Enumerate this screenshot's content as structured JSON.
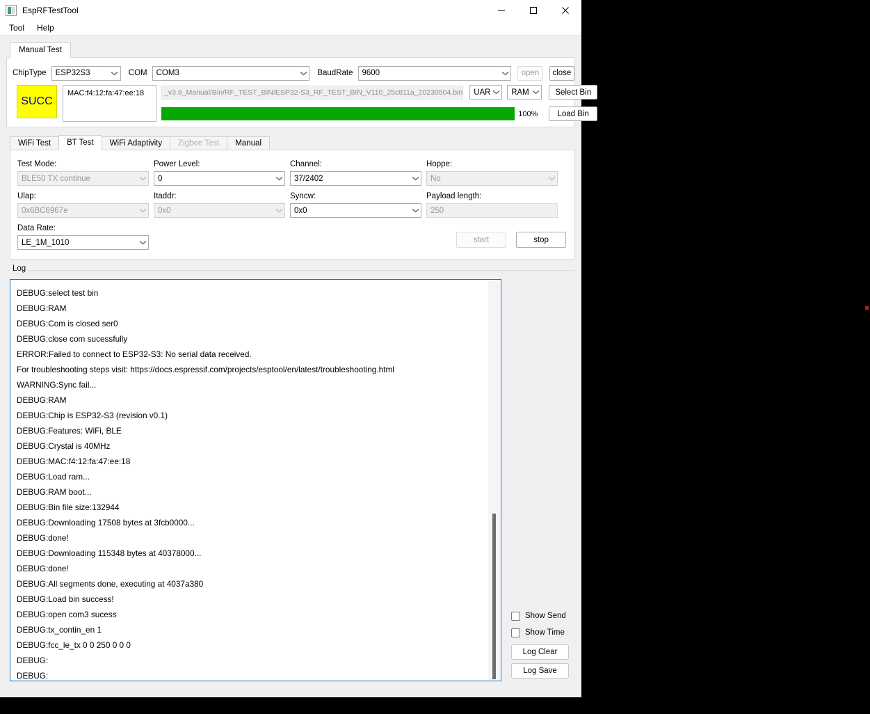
{
  "window": {
    "title": "EspRFTestTool",
    "icon": "app-icon",
    "minimize_label": "—",
    "maximize_label": "□",
    "close_label": "✕"
  },
  "menubar": {
    "items": [
      "Tool",
      "Help"
    ]
  },
  "outer_tabs": [
    {
      "label": "Manual Test",
      "active": true
    }
  ],
  "connection": {
    "chiptype_label": "ChipType",
    "chiptype_value": "ESP32S3",
    "com_label": "COM",
    "com_value": "COM3",
    "baudrate_label": "BaudRate",
    "baudrate_value": "9600",
    "open_label": "open",
    "open_enabled": false,
    "close_label": "close",
    "close_enabled": true
  },
  "status": {
    "result_badge": "SUCC",
    "result_bg": "#ffff00",
    "result_fg": "#0000c0",
    "mac_text": "MAC:f4:12:fa:47:ee:18",
    "bin_path": "_v3.6_Manual/Bin/RF_TEST_BIN/ESP32-S3_RF_TEST_BIN_V110_25c811a_20230504.bin",
    "interface_value": "UART",
    "target_value": "RAM",
    "select_bin_label": "Select Bin",
    "load_bin_label": "Load Bin",
    "progress_percent": 100,
    "progress_text": "100%",
    "progress_color": "#06a806"
  },
  "inner_tabs": [
    {
      "label": "WiFi Test",
      "active": false,
      "enabled": true
    },
    {
      "label": "BT Test",
      "active": true,
      "enabled": true
    },
    {
      "label": "WiFi Adaptivity",
      "active": false,
      "enabled": true
    },
    {
      "label": "Zigbee Test",
      "active": false,
      "enabled": false
    },
    {
      "label": "Manual",
      "active": false,
      "enabled": true
    }
  ],
  "bt_test": {
    "fields": [
      {
        "label": "Test Mode:",
        "value": "BLE50 TX continue",
        "type": "combo",
        "enabled": false
      },
      {
        "label": "Power Level:",
        "value": "0",
        "type": "combo",
        "enabled": true
      },
      {
        "label": "Channel:",
        "value": "37/2402",
        "type": "combo",
        "enabled": true
      },
      {
        "label": "Hoppe:",
        "value": "No",
        "type": "combo",
        "enabled": false
      },
      {
        "label": "Ulap:",
        "value": "0x6BC6967e",
        "type": "combo",
        "enabled": false
      },
      {
        "label": "Itaddr:",
        "value": "0x0",
        "type": "combo",
        "enabled": false
      },
      {
        "label": "Syncw:",
        "value": "0x0",
        "type": "combo",
        "enabled": true
      },
      {
        "label": "Payload length:",
        "value": "250",
        "type": "text",
        "enabled": false
      },
      {
        "label": "Data Rate:",
        "value": "LE_1M_1010",
        "type": "combo",
        "enabled": true
      }
    ],
    "start_label": "start",
    "start_enabled": false,
    "stop_label": "stop",
    "stop_enabled": true
  },
  "log": {
    "group_label": "Log",
    "lines": [
      "DEBUG:select test bin",
      "DEBUG:RAM",
      "DEBUG:Com is closed ser0",
      "DEBUG:close com sucessfully",
      "ERROR:Failed to connect to ESP32-S3: No serial data received.",
      "For troubleshooting steps visit: https://docs.espressif.com/projects/esptool/en/latest/troubleshooting.html",
      "WARNING:Sync fail...",
      "DEBUG:RAM",
      "DEBUG:Chip is ESP32-S3 (revision v0.1)",
      "DEBUG:Features: WiFi, BLE",
      "DEBUG:Crystal is 40MHz",
      "DEBUG:MAC:f4:12:fa:47:ee:18",
      "DEBUG:Load ram...",
      "DEBUG:RAM boot...",
      "DEBUG:Bin file size:132944",
      "DEBUG:Downloading 17508 bytes at 3fcb0000...",
      "DEBUG:done!",
      "DEBUG:Downloading 115348 bytes at 40378000...",
      "DEBUG:done!",
      "DEBUG:All segments done, executing at 4037a380",
      "DEBUG:Load bin success!",
      "DEBUG:open com3 sucess",
      "DEBUG:tx_contin_en 1",
      "DEBUG:fcc_le_tx 0 0 250 0 0 0",
      "DEBUG:",
      "DEBUG:"
    ],
    "show_send_label": "Show Send",
    "show_send_checked": false,
    "show_time_label": "Show Time",
    "show_time_checked": false,
    "log_clear_label": "Log Clear",
    "log_save_label": "Log Save"
  }
}
